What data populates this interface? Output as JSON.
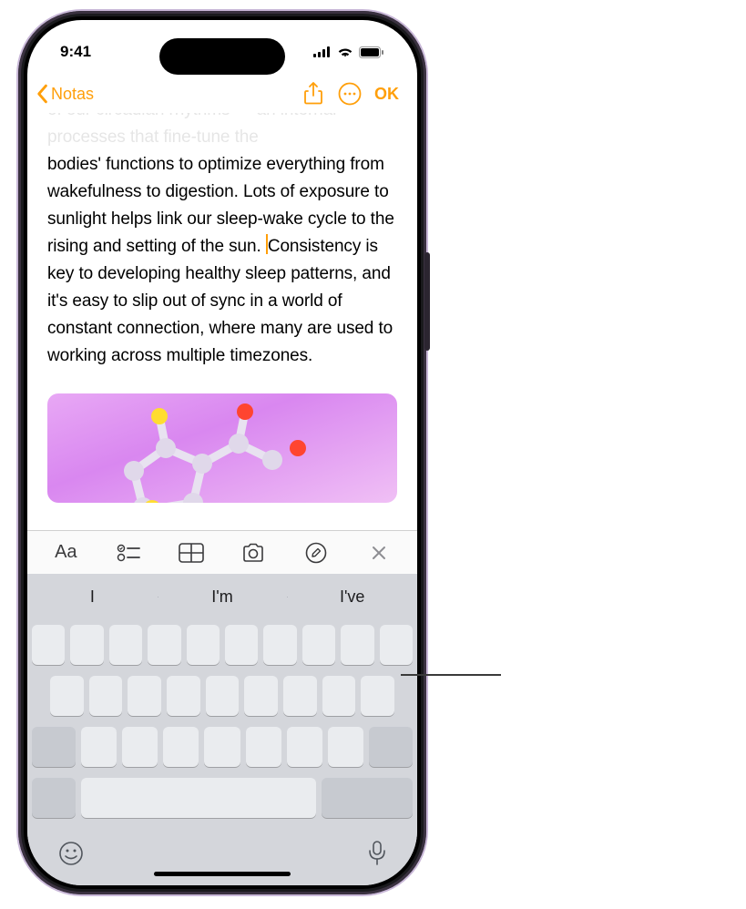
{
  "status": {
    "time": "9:41"
  },
  "nav": {
    "back_label": "Notas",
    "done_label": "OK"
  },
  "note": {
    "faded_lines": "Sunlight has a profound effect on the sleep-wake cycle, serving as a powerful orchestrant of our circadian rhythms — an internal processes that fine-tune the",
    "body_before_cursor": "bodies' functions to optimize everything from wakefulness to digestion. Lots of exposure to sunlight helps link our sleep-wake cycle to the rising and setting of the sun.",
    "body_after_cursor": "Consistency is key to developing healthy sleep patterns, and it's easy to slip out of sync in a world of constant connection, where many are used to working across multiple timezones."
  },
  "predictive": {
    "items": [
      "I",
      "I'm",
      "I've"
    ]
  },
  "icons": {
    "format_text": "Aa",
    "format_checklist": "checklist",
    "format_table": "table",
    "format_camera": "camera",
    "format_markup": "markup",
    "format_close": "close",
    "emoji": "emoji",
    "mic": "mic"
  }
}
